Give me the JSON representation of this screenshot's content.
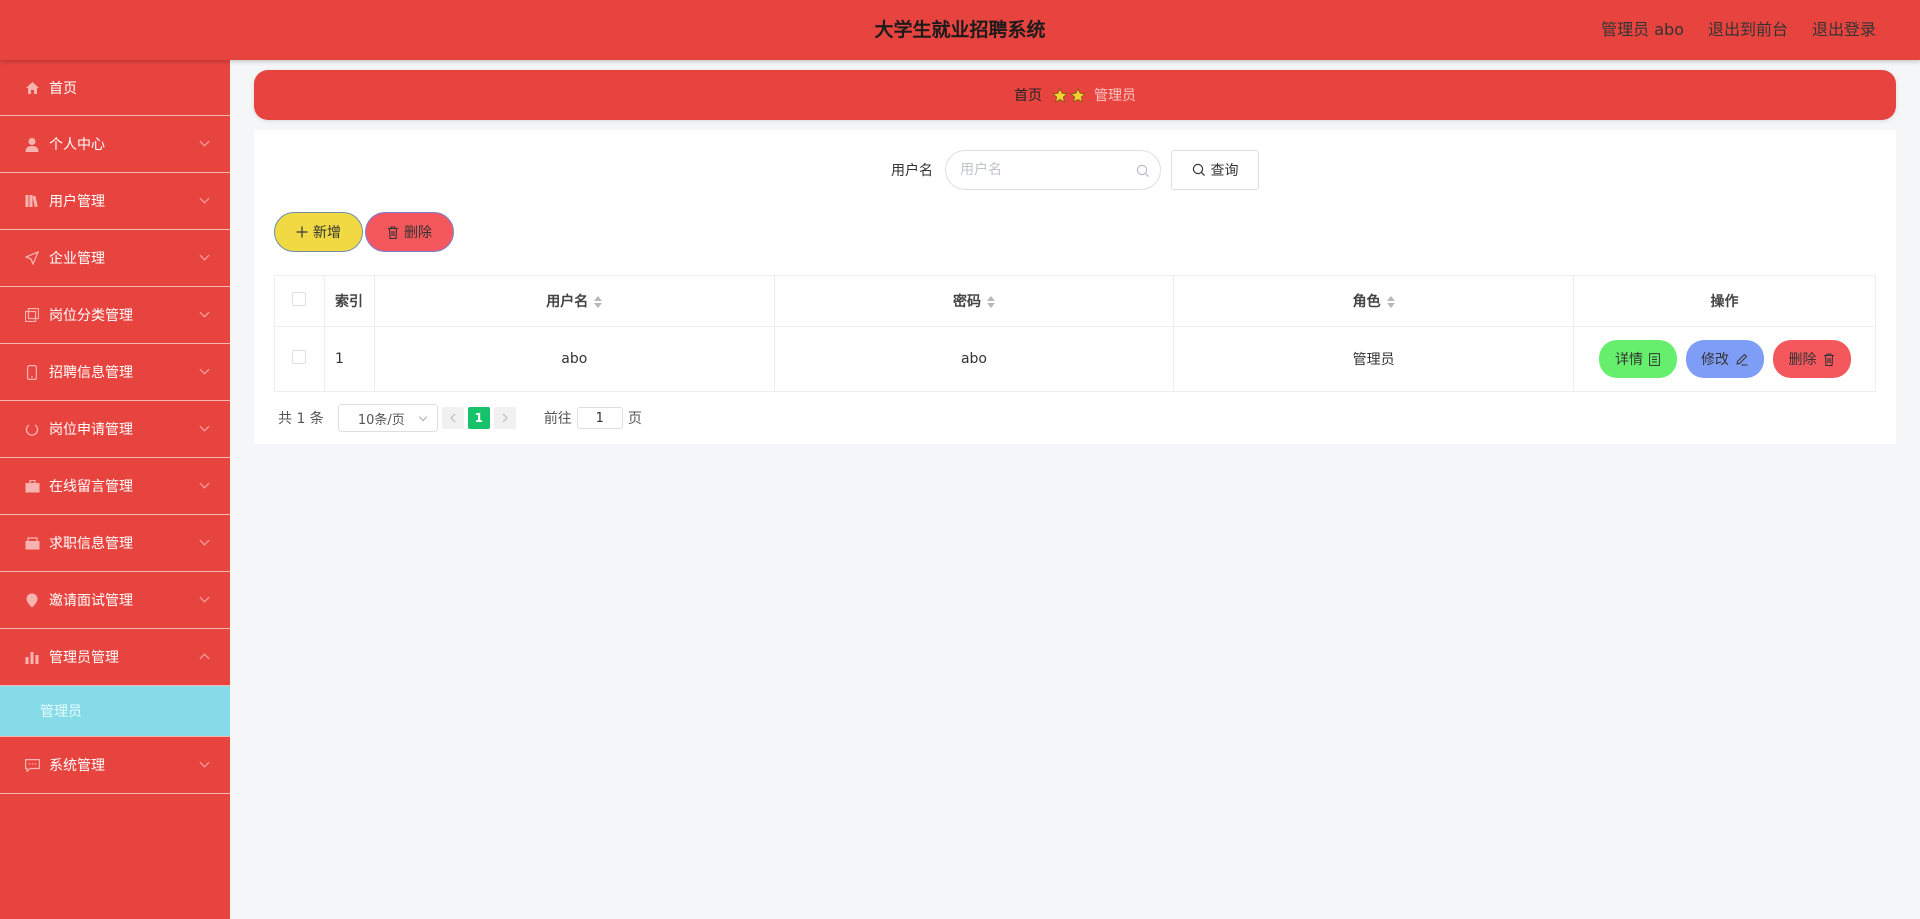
{
  "header": {
    "title": "大学生就业招聘系统",
    "user_label": "管理员 abo",
    "to_front_label": "退出到前台",
    "logout_label": "退出登录"
  },
  "colors": {
    "primary": "#e8443f",
    "submenu_active": "#86dbe8",
    "add_button": "#f0d943",
    "delete_button": "#f4585c",
    "detail_button": "#65ef6c",
    "edit_button": "#7e9df6",
    "page_active": "#16c26a"
  },
  "sidebar": {
    "items": [
      {
        "label": "首页",
        "icon": "home-icon"
      },
      {
        "label": "个人中心",
        "icon": "user-icon"
      },
      {
        "label": "用户管理",
        "icon": "books-icon"
      },
      {
        "label": "企业管理",
        "icon": "send-icon"
      },
      {
        "label": "岗位分类管理",
        "icon": "copy-icon"
      },
      {
        "label": "招聘信息管理",
        "icon": "phone-icon"
      },
      {
        "label": "岗位申请管理",
        "icon": "power-icon"
      },
      {
        "label": "在线留言管理",
        "icon": "briefcase-icon"
      },
      {
        "label": "求职信息管理",
        "icon": "suitcase-icon"
      },
      {
        "label": "邀请面试管理",
        "icon": "location-icon"
      },
      {
        "label": "管理员管理",
        "icon": "bar-chart-icon"
      },
      {
        "label": "系统管理",
        "icon": "message-icon"
      }
    ],
    "sub_active": "管理员"
  },
  "breadcrumb": {
    "home": "首页",
    "current": "管理员"
  },
  "search": {
    "label": "用户名",
    "placeholder": "用户名",
    "button_label": "查询"
  },
  "actions": {
    "add_label": "新增",
    "delete_label": "删除"
  },
  "table": {
    "headers": {
      "index": "索引",
      "username": "用户名",
      "password": "密码",
      "role": "角色",
      "actions": "操作"
    },
    "rows": [
      {
        "index": "1",
        "username": "abo",
        "password": "abo",
        "role": "管理员"
      }
    ],
    "row_actions": {
      "detail": "详情",
      "edit": "修改",
      "delete": "删除"
    }
  },
  "pagination": {
    "total": "共 1 条",
    "page_size": "10条/页",
    "current_page": "1",
    "goto_prefix": "前往",
    "goto_value": "1",
    "goto_suffix": "页"
  }
}
